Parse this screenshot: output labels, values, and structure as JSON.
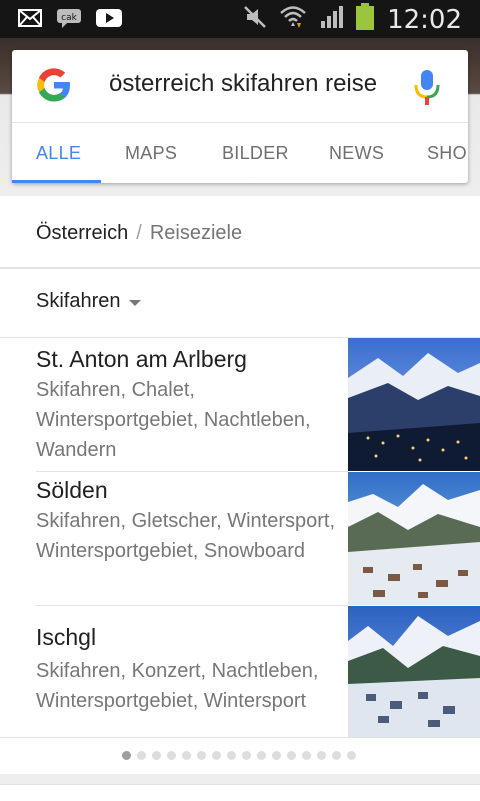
{
  "status_bar": {
    "time": "12:02",
    "left_icons": [
      "mail-icon",
      "chat-icon",
      "youtube-icon"
    ],
    "right_icons": [
      "muted-icon",
      "wifi-icon",
      "signal-icon",
      "battery-icon"
    ]
  },
  "search": {
    "query": "österreich skifahren reise"
  },
  "tabs": [
    {
      "label": "ALLE",
      "active": true
    },
    {
      "label": "MAPS",
      "active": false
    },
    {
      "label": "BILDER",
      "active": false
    },
    {
      "label": "NEWS",
      "active": false
    },
    {
      "label": "SHOP",
      "active": false
    }
  ],
  "breadcrumb": {
    "parent": "Österreich",
    "separator": "/",
    "current": "Reiseziele"
  },
  "filter": {
    "label": "Skifahren"
  },
  "results": [
    {
      "title": "St. Anton am Arlberg",
      "tags": "Skifahren, Chalet, Wintersportgebiet, Nachtleben, Wandern"
    },
    {
      "title": "Sölden",
      "tags": "Skifahren, Gletscher, Wintersport, Wintersportgebiet, Snowboard"
    },
    {
      "title": "Ischgl",
      "tags": "Skifahren, Konzert, Nachtleben, Wintersportgebiet, Wintersport"
    }
  ],
  "pagination": {
    "total_dots": 16,
    "active_index": 0
  },
  "colors": {
    "accent": "#4285f4",
    "status_bar": "#151515",
    "secondary_text": "#777777"
  }
}
